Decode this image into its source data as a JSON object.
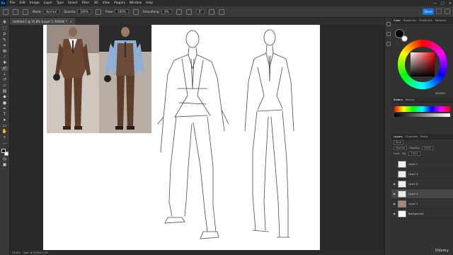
{
  "menubar": {
    "logo": "Ps",
    "items": [
      "File",
      "Edit",
      "Image",
      "Layer",
      "Type",
      "Select",
      "Filter",
      "3D",
      "View",
      "Plugins",
      "Window",
      "Help"
    ],
    "window_controls": [
      "—",
      "□",
      "✕"
    ]
  },
  "options": {
    "mode_label": "Mode:",
    "mode_value": "Normal",
    "opacity_label": "Opacity:",
    "opacity_value": "100%",
    "flow_label": "Flow:",
    "flow_value": "100%",
    "smoothing_label": "Smoothing:",
    "smoothing_value": "0%",
    "angle_value": "0°",
    "share_label": "Share"
  },
  "document": {
    "tab_title": "Untitled-1 @ 25.8% (Layer 5, RGB/8) *",
    "close_glyph": "×"
  },
  "status": {
    "zoom": "25.8%",
    "info": "Doc: 8.93M/43.7M"
  },
  "panels": {
    "color_tabs": [
      "Color",
      "Swatches",
      "Gradients",
      "Patterns"
    ],
    "hue_value": "000000",
    "swatch_tabs": [
      "Sliders",
      "Mixers"
    ],
    "layer_tabs": [
      "Layers",
      "Channels",
      "Paths"
    ],
    "kind_label": "Kind",
    "blend_mode": "Normal",
    "opacity_label": "Opacity:",
    "opacity_value": "100%",
    "lock_label": "Lock:",
    "fill_label": "Fill:",
    "fill_value": "100%",
    "layers": [
      {
        "name": "Layer 2",
        "visible": false,
        "selected": false
      },
      {
        "name": "Layer 4",
        "visible": false,
        "selected": false
      },
      {
        "name": "Layer 6",
        "visible": true,
        "selected": false
      },
      {
        "name": "Layer 5",
        "visible": true,
        "selected": true
      },
      {
        "name": "Layer 1",
        "visible": true,
        "selected": false
      },
      {
        "name": "Background",
        "visible": true,
        "selected": false
      }
    ]
  },
  "watermark": "Udemy",
  "colors": {
    "accent": "#1473e6",
    "panel": "#323232",
    "canvas": "#ffffff"
  }
}
